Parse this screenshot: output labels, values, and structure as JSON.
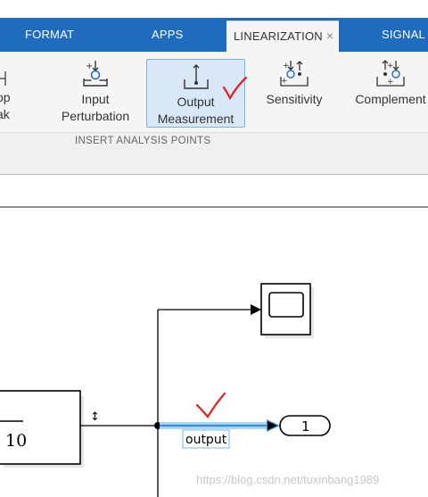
{
  "tabs": {
    "format": "FORMAT",
    "apps": "APPS",
    "linearization": "LINEARIZATION",
    "close_glyph": "×",
    "signal": "SIGNAL"
  },
  "ribbon": {
    "loop_break_line1": "op",
    "loop_break_line2": "ak",
    "input_perturbation_line1": "Input",
    "input_perturbation_line2": "Perturbation",
    "output_measurement_line1": "Output",
    "output_measurement_line2": "Measurement",
    "sensitivity": "Sensitivity",
    "complement": "Complement",
    "group_label": "INSERT ANALYSIS POINTS"
  },
  "diagram": {
    "transfer_denominator": "10",
    "outport_number": "1",
    "signal_label": "output",
    "analysis_arrow": "↕"
  },
  "watermark": "https://blog.csdn.net/tuxinbang1989",
  "colors": {
    "tab_bar": "#1f6bbd",
    "selection": "#d8e8f6",
    "signal_highlight": "#56b4f0",
    "check_mark": "#e02020"
  }
}
